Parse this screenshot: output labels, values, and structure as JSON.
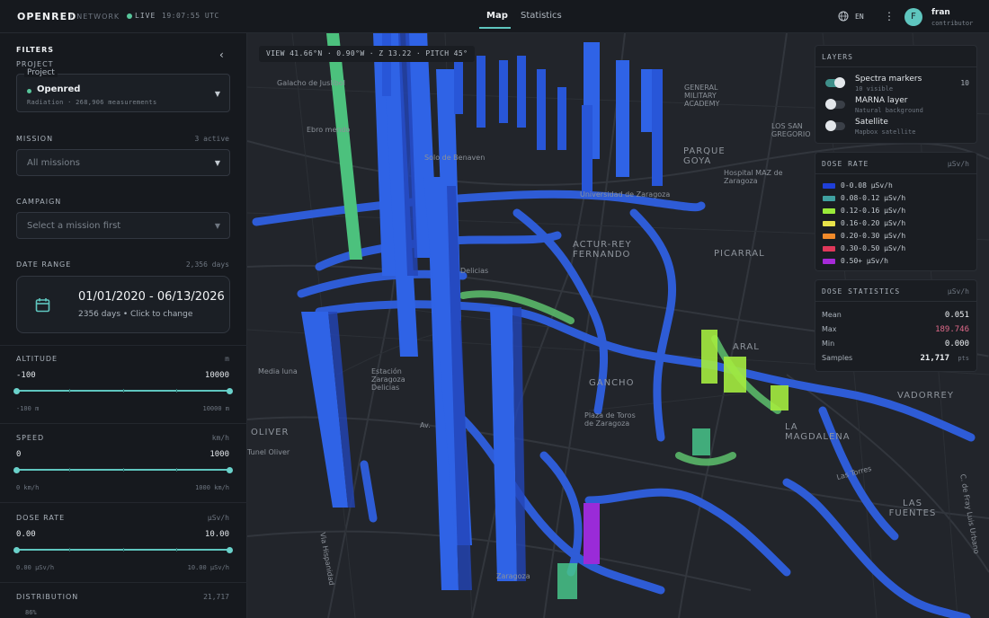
{
  "header": {
    "brand": "OPENRED",
    "brand_sub": "/ NETWORK",
    "live_label": "LIVE",
    "live_time": "19:07:55 UTC",
    "tabs": [
      {
        "label": "Map"
      },
      {
        "label": "Statistics"
      }
    ],
    "language": "EN",
    "avatar_letter": "F",
    "user_name": "fran",
    "user_role": "contributor"
  },
  "sidebar": {
    "title": "FILTERS",
    "project": {
      "section": "PROJECT",
      "label": "Project",
      "name": "Openred",
      "sub": "Radiation · 268,906 measurements"
    },
    "mission": {
      "section": "MISSION",
      "count": "3 active",
      "placeholder": "All missions"
    },
    "campaign": {
      "section": "CAMPAIGN",
      "placeholder": "Select a mission first"
    },
    "date_range": {
      "section": "DATE RANGE",
      "count": "2,356 days",
      "value": "01/01/2020 - 06/13/2026",
      "sub": "2356 days • Click to change"
    },
    "altitude": {
      "section": "ALTITUDE",
      "unit": "m",
      "min": "-100",
      "max": "10000",
      "min_sub": "-100 m",
      "max_sub": "10000 m"
    },
    "speed": {
      "section": "SPEED",
      "unit": "km/h",
      "min": "0",
      "max": "1000",
      "min_sub": "0 km/h",
      "max_sub": "1000 km/h"
    },
    "dose_rate": {
      "section": "DOSE RATE",
      "unit": "µSv/h",
      "min": "0.00",
      "max": "10.00",
      "min_sub": "0.00 µSv/h",
      "max_sub": "10.00 µSv/h"
    },
    "distribution": {
      "section": "DISTRIBUTION",
      "count": "21,717",
      "first_bar": "86%"
    }
  },
  "map": {
    "view": "VIEW 41.66°N · 0.90°W · Z 13.22 · PITCH 45°",
    "labels": [
      "Galacho de Juslibol",
      "Ebro mendo",
      "Solo de Benaven",
      "GENERAL MILITARY ACADEMY",
      "LOS SAN GREGORIO",
      "PARQUE GOYA",
      "Hospital MAZ de Zaragoza",
      "Universidad de Zaragoza",
      "ACTUR-REY FERNANDO",
      "PICARRAL",
      "Delicias",
      "Media luna",
      "Estación Zaragoza Delicias",
      "GANCHO",
      "OLIVER",
      "Tunel Oliver",
      "Via Hispanidad",
      "Plaza de Toros de Zaragoza",
      "LA MAGDALENA",
      "VADORREY",
      "Las Torres",
      "LAS FUENTES",
      "C. de Fray Luis Urbano",
      "Zaragoza",
      "Av.",
      "ARAL"
    ]
  },
  "layers": {
    "title": "LAYERS",
    "items": [
      {
        "name": "Spectra markers",
        "sub": "10 visible",
        "count": "10",
        "on": true
      },
      {
        "name": "MARNA layer",
        "sub": "Natural background",
        "count": "",
        "on": false
      },
      {
        "name": "Satellite",
        "sub": "Mapbox satellite",
        "count": "",
        "on": false
      }
    ]
  },
  "legend": {
    "title": "DOSE RATE",
    "unit": "µSv/h",
    "items": [
      {
        "label": "0-0.08 µSv/h",
        "color": "#1f3fd8"
      },
      {
        "label": "0.08-0.12 µSv/h",
        "color": "#3fa0a0"
      },
      {
        "label": "0.12-0.16 µSv/h",
        "color": "#9aea3a"
      },
      {
        "label": "0.16-0.20 µSv/h",
        "color": "#e8e24a"
      },
      {
        "label": "0.20-0.30 µSv/h",
        "color": "#f08a2a"
      },
      {
        "label": "0.30-0.50 µSv/h",
        "color": "#e0385a"
      },
      {
        "label": "0.50+ µSv/h",
        "color": "#a62ad8"
      }
    ]
  },
  "stats": {
    "title": "DOSE STATISTICS",
    "unit": "µSv/h",
    "mean_label": "Mean",
    "mean": "0.051",
    "max_label": "Max",
    "max": "189.746",
    "min_label": "Min",
    "min": "0.000",
    "samples_label": "Samples",
    "samples": "21,717",
    "samples_unit": "pts"
  },
  "colors": {
    "accent": "#5fc6bf",
    "max_value": "#e06a8a",
    "live": "#58c69b"
  }
}
